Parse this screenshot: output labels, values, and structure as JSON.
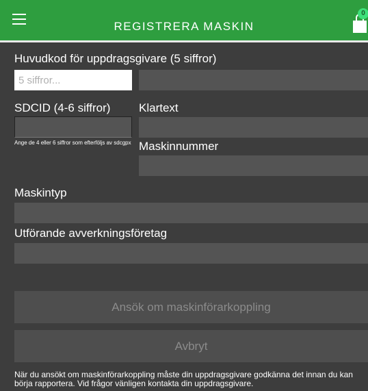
{
  "header": {
    "title": "REGISTRERA MASKIN",
    "cart_count": "0",
    "accent": "#2e9e3f"
  },
  "form": {
    "huvudkod_label": "Huvudkod för uppdragsgivare (5 siffror)",
    "huvudkod_placeholder": "5 siffror...",
    "sdcid_label": "SDCID (4-6 siffror)",
    "sdcid_hint": "Ange de 4 eller 6 siffror som efterföljs av sdcgpx",
    "klartext_label": "Klartext",
    "maskinnummer_label": "Maskinnummer",
    "maskintyp_label": "Maskintyp",
    "utforande_label": "Utförande avverkningsföretag"
  },
  "buttons": {
    "apply": "Ansök om maskinförarkoppling",
    "cancel": "Avbryt"
  },
  "footer": {
    "note": "När du ansökt om maskinförarkoppling måste din uppdragsgivare godkänna det innan du kan börja rapportera. Vid frågor vänligen kontakta din uppdragsgivare."
  }
}
